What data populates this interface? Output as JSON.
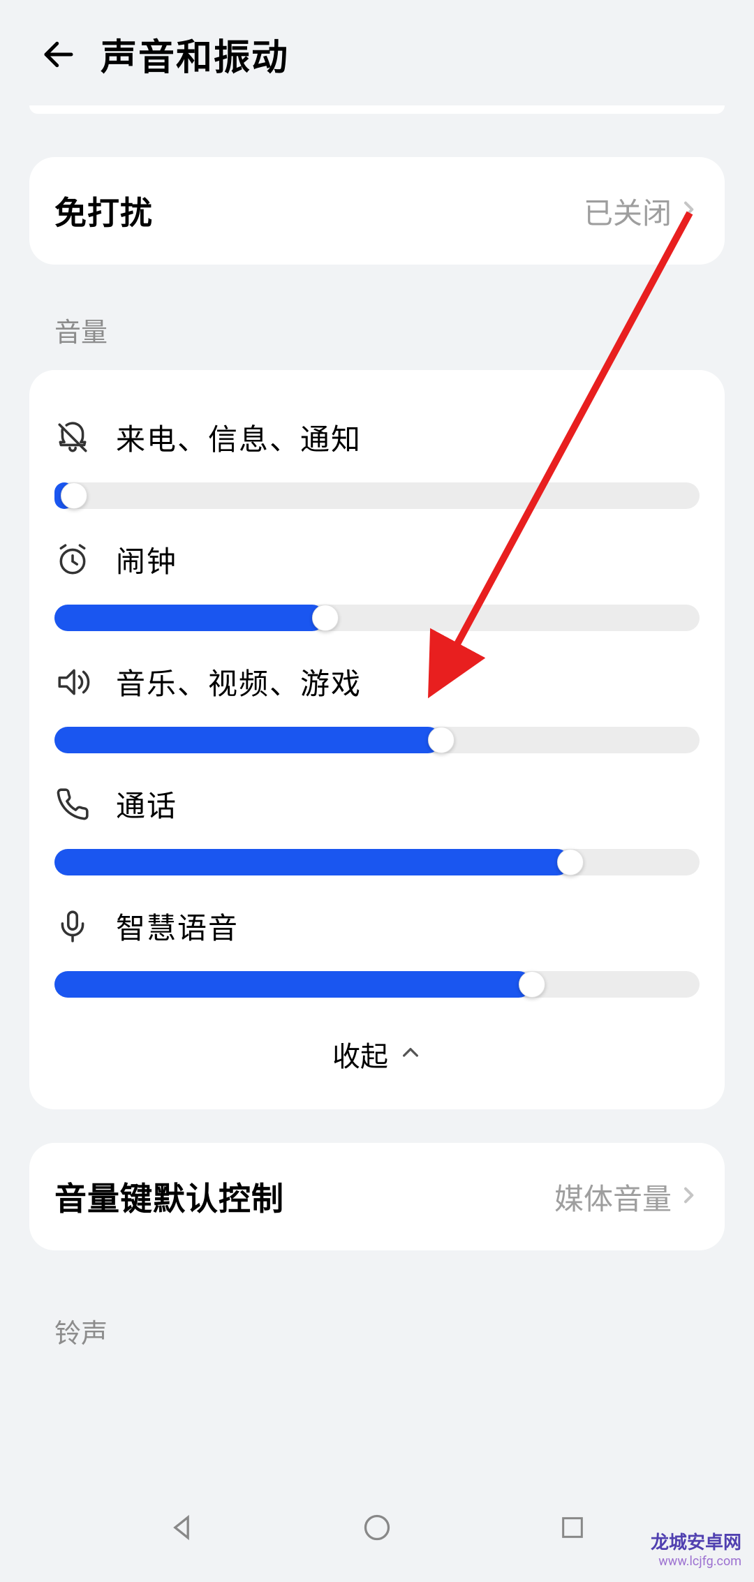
{
  "header": {
    "title": "声音和振动"
  },
  "dnd": {
    "label": "免打扰",
    "value": "已关闭"
  },
  "volume_section": {
    "label": "音量",
    "collapse_label": "收起",
    "sliders": [
      {
        "icon": "bell-off-icon",
        "label": "来电、信息、通知",
        "value": 1
      },
      {
        "icon": "alarm-icon",
        "label": "闹钟",
        "value": 42
      },
      {
        "icon": "speaker-icon",
        "label": "音乐、视频、游戏",
        "value": 60
      },
      {
        "icon": "phone-icon",
        "label": "通话",
        "value": 80
      },
      {
        "icon": "mic-icon",
        "label": "智慧语音",
        "value": 74
      }
    ]
  },
  "volume_key": {
    "label": "音量键默认控制",
    "value": "媒体音量"
  },
  "ringtone_section": {
    "label": "铃声"
  },
  "watermark": {
    "line1": "龙城安卓网",
    "line2": "www.lcjfg.com"
  }
}
